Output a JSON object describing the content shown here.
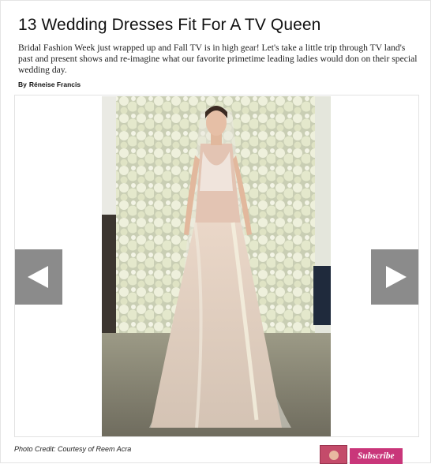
{
  "article": {
    "title": "13 Wedding Dresses Fit For A TV Queen",
    "intro": "Bridal Fashion Week just wrapped up and Fall TV is in high gear! Let's take a little trip through TV land's past and present shows and re-imagine what our favorite primetime leading ladies would don on their special wedding day.",
    "byline_prefix": "By",
    "author": "Réneise Francis"
  },
  "gallery": {
    "prev_icon": "left-arrow-icon",
    "next_icon": "right-arrow-icon",
    "arrow_color": "#8b8b8b",
    "credit": "Photo Credit: Courtesy of Reem Acra"
  },
  "promo": {
    "subscribe_label": "Subscribe",
    "button_color": "#c9367a"
  }
}
